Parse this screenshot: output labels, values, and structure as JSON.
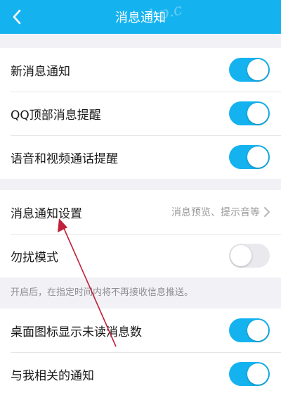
{
  "header": {
    "title": "消息通知",
    "watermark": "hp.c"
  },
  "colors": {
    "accent": "#14b3f0",
    "annotation_arrow": "#c0203a"
  },
  "icons": {
    "back": "chevron-left-icon",
    "row_more": "chevron-right-icon"
  },
  "group1": [
    {
      "label": "新消息通知",
      "toggle": "on"
    },
    {
      "label": "QQ顶部消息提醒",
      "toggle": "on"
    },
    {
      "label": "语音和视频通话提醒",
      "toggle": "on"
    }
  ],
  "group2": {
    "settings": {
      "label": "消息通知设置",
      "value": "消息预览、提示音等"
    },
    "dnd": {
      "label": "勿扰模式",
      "toggle": "off"
    }
  },
  "dnd_note": "开启后，在指定时间内将不再接收信息推送。",
  "group3": [
    {
      "label": "桌面图标显示未读消息数",
      "toggle": "on"
    },
    {
      "label": "与我相关的通知",
      "toggle": "on"
    }
  ]
}
